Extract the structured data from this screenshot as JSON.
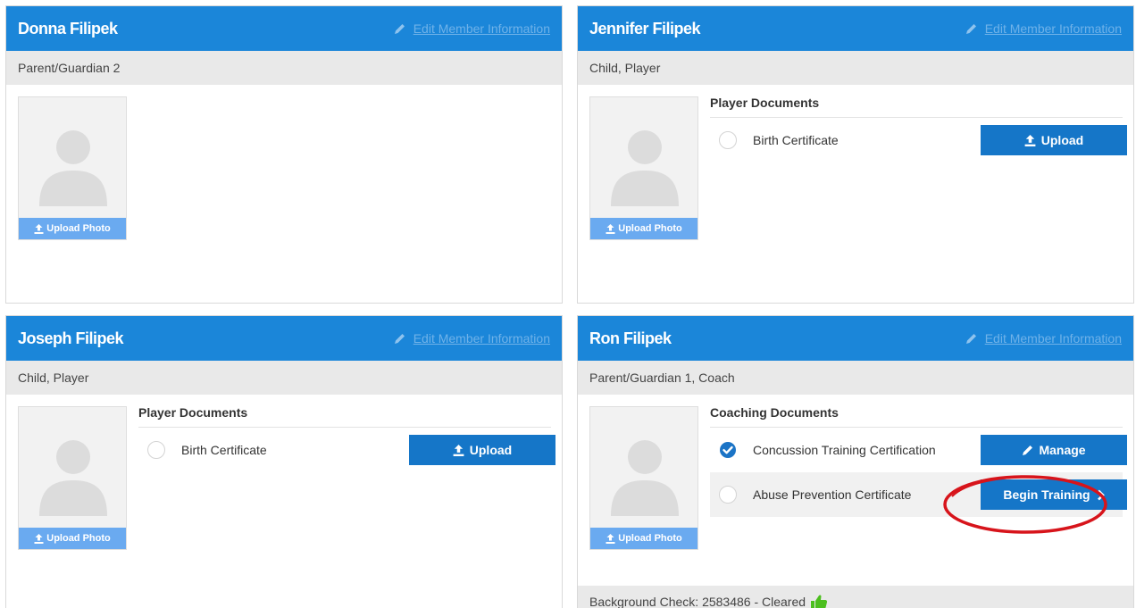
{
  "edit_label": "Edit Member Information",
  "upload_photo_label": "Upload Photo",
  "colors": {
    "header": "#1b86d9",
    "button": "#1576c8",
    "upload_photo": "#6aaaf0",
    "check": "#1b74c6",
    "annotation_ring": "#d7141b",
    "thumbs_up": "#4cbf1f"
  },
  "members": [
    {
      "name": "Donna Filipek",
      "role": "Parent/Guardian 2"
    },
    {
      "name": "Jennifer Filipek",
      "role": "Child, Player",
      "docs_title": "Player Documents",
      "docs": [
        {
          "name": "Birth Certificate",
          "status": "incomplete",
          "action": "Upload",
          "action_icon": "upload-icon"
        }
      ]
    },
    {
      "name": "Joseph Filipek",
      "role": "Child, Player",
      "docs_title": "Player Documents",
      "docs": [
        {
          "name": "Birth Certificate",
          "status": "incomplete",
          "action": "Upload",
          "action_icon": "upload-icon"
        }
      ]
    },
    {
      "name": "Ron Filipek",
      "role": "Parent/Guardian 1, Coach",
      "docs_title": "Coaching Documents",
      "docs": [
        {
          "name": "Concussion Training Certification",
          "status": "complete",
          "action": "Manage",
          "action_icon": "pencil-icon"
        },
        {
          "name": "Abuse Prevention Certificate",
          "status": "incomplete",
          "action": "Begin Training",
          "action_icon": "chevron-right-icon"
        }
      ],
      "background_check": "Background Check: 2583486 - Cleared",
      "background_check_icon": "thumbs-up-icon"
    }
  ]
}
